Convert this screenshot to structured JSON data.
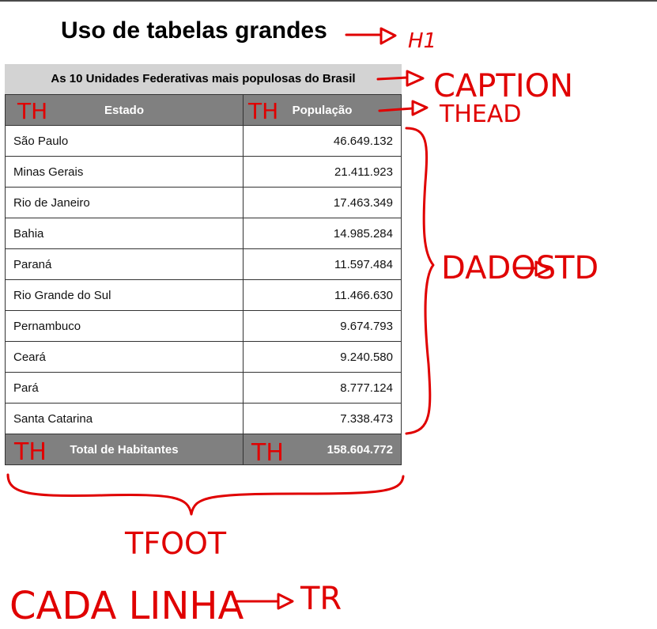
{
  "title": "Uso de tabelas grandes",
  "table": {
    "caption": "As 10 Unidades Federativas mais populosas do Brasil",
    "headers": [
      "Estado",
      "População"
    ],
    "rows": [
      [
        "São Paulo",
        "46.649.132"
      ],
      [
        "Minas Gerais",
        "21.411.923"
      ],
      [
        "Rio de Janeiro",
        "17.463.349"
      ],
      [
        "Bahia",
        "14.985.284"
      ],
      [
        "Paraná",
        "11.597.484"
      ],
      [
        "Rio Grande do Sul",
        "11.466.630"
      ],
      [
        "Pernambuco",
        "9.674.793"
      ],
      [
        "Ceará",
        "9.240.580"
      ],
      [
        "Pará",
        "8.777.124"
      ],
      [
        "Santa Catarina",
        "7.338.473"
      ]
    ],
    "footer": [
      "Total de Habitantes",
      "158.604.772"
    ]
  },
  "annotations": {
    "h1": "H1",
    "caption": "CAPTION",
    "thead": "THEAD",
    "th": "TH",
    "dados": "DADOS",
    "td": "TD",
    "tfoot": "TFOOT",
    "cada_linha": "CADA LINHA",
    "tr": "TR",
    "color": "#e00000"
  },
  "colors": {
    "caption_bg": "#d3d3d3",
    "header_bg": "#808080",
    "header_text": "#ffffff"
  }
}
